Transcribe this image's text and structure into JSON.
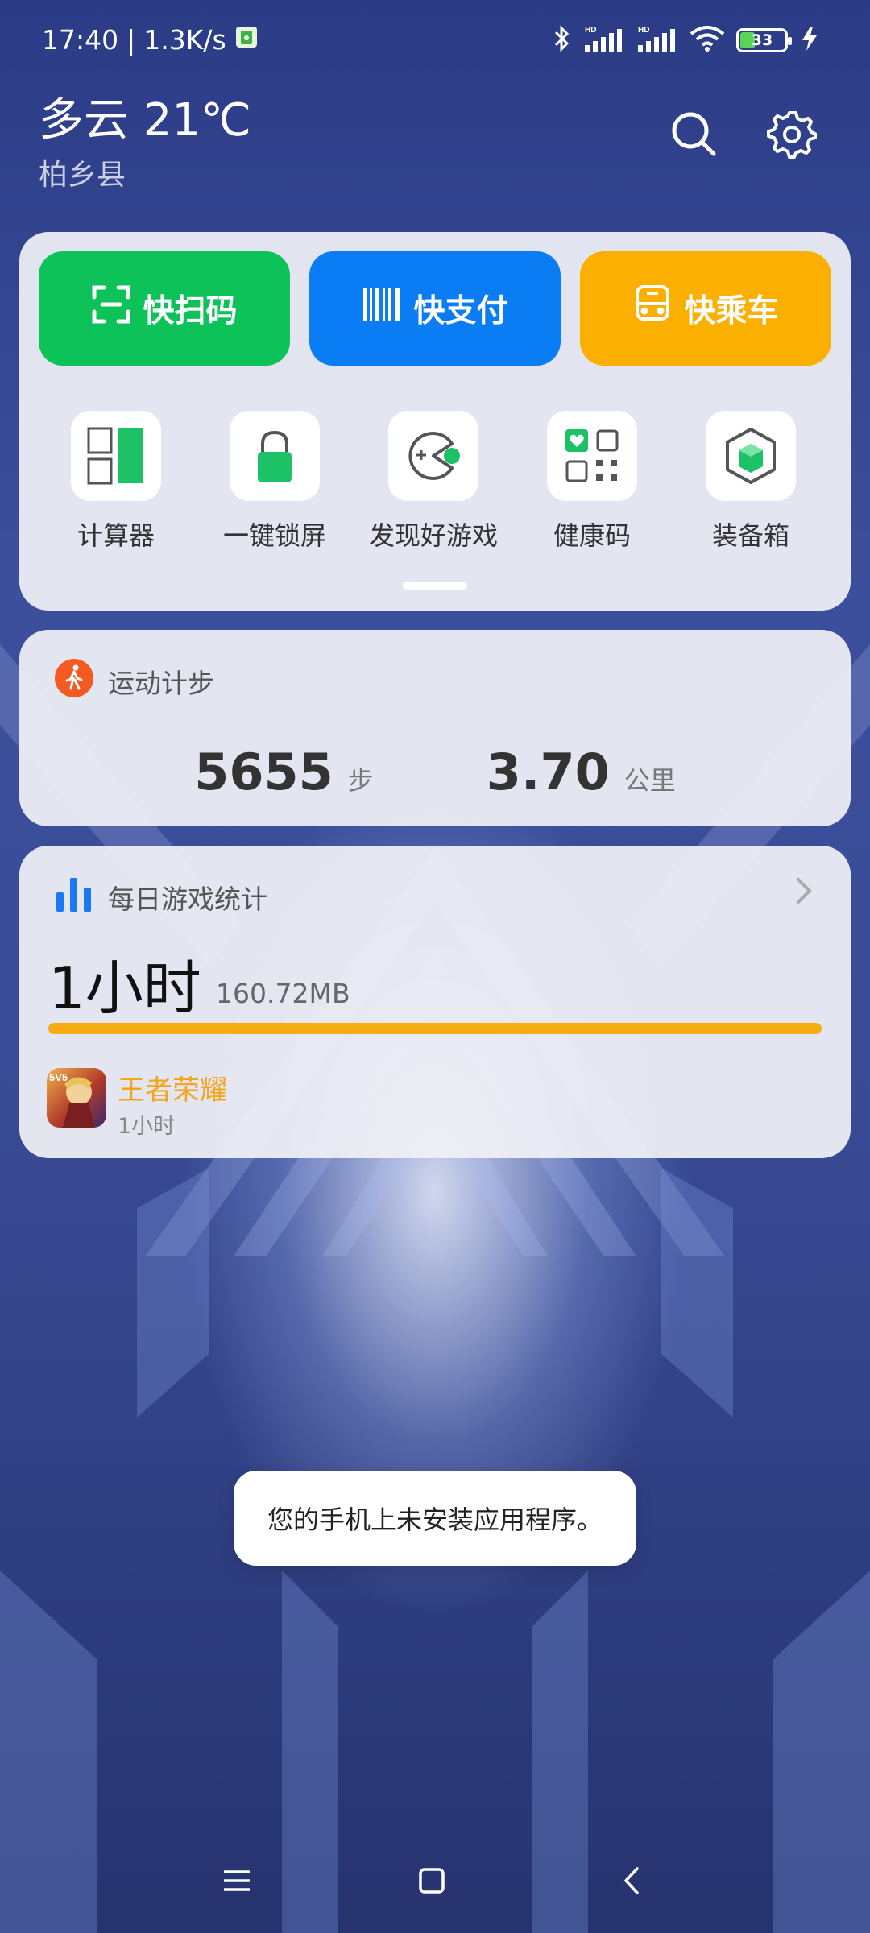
{
  "status_bar": {
    "time": "17:40",
    "separator": "|",
    "net_speed": "1.3K/s",
    "battery_level": "33",
    "icons": [
      "app-notification-icon",
      "bluetooth-icon",
      "hd-signal-icon",
      "hd-signal-icon",
      "wifi-icon",
      "battery-icon",
      "charging-icon"
    ]
  },
  "weather": {
    "summary": "多云 21℃",
    "location": "柏乡县"
  },
  "header_icons": [
    "search-icon",
    "settings-icon"
  ],
  "quick_actions": [
    {
      "label": "快扫码",
      "icon": "scan-icon",
      "color": "#0ec25a"
    },
    {
      "label": "快支付",
      "icon": "barcode-icon",
      "color": "#0a7df5"
    },
    {
      "label": "快乘车",
      "icon": "bus-icon",
      "color": "#fbaf00"
    }
  ],
  "tools": [
    {
      "label": "计算器",
      "icon": "calculator-icon"
    },
    {
      "label": "一键锁屏",
      "icon": "lock-icon"
    },
    {
      "label": "发现好游戏",
      "icon": "game-controller-icon"
    },
    {
      "label": "健康码",
      "icon": "health-qr-icon"
    },
    {
      "label": "装备箱",
      "icon": "cube-icon"
    }
  ],
  "steps": {
    "title": "运动计步",
    "steps_value": "5655",
    "steps_unit": "步",
    "distance_value": "3.70",
    "distance_unit": "公里"
  },
  "game_stats": {
    "title": "每日游戏统计",
    "total_time": "1小时",
    "data_used": "160.72MB",
    "bar_color": "#f7ac14",
    "apps": [
      {
        "name": "王者荣耀",
        "time": "1小时",
        "icon_text": "5V5"
      }
    ]
  },
  "toast": {
    "message": "您的手机上未安装应用程序。"
  },
  "nav_bar": [
    "menu-icon",
    "home-icon",
    "back-icon"
  ]
}
